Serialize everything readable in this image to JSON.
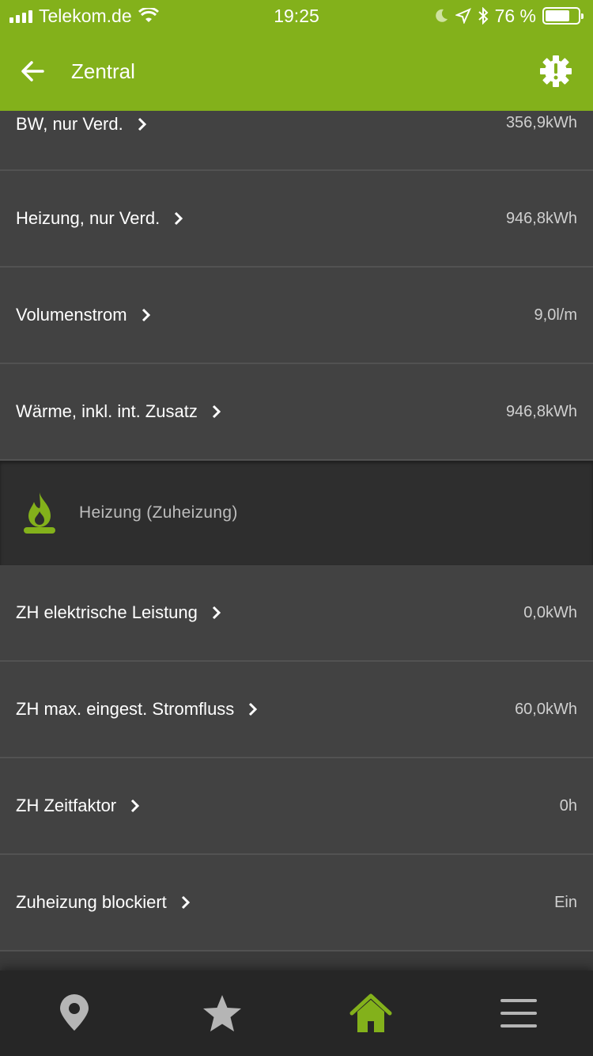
{
  "status": {
    "carrier": "Telekom.de",
    "time": "19:25",
    "battery": "76 %",
    "battery_level": 0.76
  },
  "appbar": {
    "title": "Zentral",
    "back_icon": "arrow-left-icon",
    "alert_icon": "gear-alert-icon"
  },
  "rows_top": [
    {
      "label": "BW, nur Verd.",
      "value": "356,9kWh"
    },
    {
      "label": "Heizung, nur Verd.",
      "value": "946,8kWh"
    },
    {
      "label": "Volumenstrom",
      "value": "9,0l/m"
    },
    {
      "label": "Wärme, inkl. int. Zusatz",
      "value": "946,8kWh"
    }
  ],
  "section": {
    "title": "Heizung (Zuheizung)",
    "icon": "flame-icon"
  },
  "rows_bottom": [
    {
      "label": "ZH elektrische Leistung",
      "value": "0,0kWh"
    },
    {
      "label": "ZH max. eingest. Stromfluss",
      "value": "60,0kWh"
    },
    {
      "label": "ZH Zeitfaktor",
      "value": "0h"
    },
    {
      "label": "Zuheizung blockiert",
      "value": "Ein"
    }
  ],
  "bottom_nav": [
    {
      "icon": "location-pin-icon",
      "active": false
    },
    {
      "icon": "star-icon",
      "active": false
    },
    {
      "icon": "home-icon",
      "active": true
    },
    {
      "icon": "menu-icon",
      "active": false
    }
  ],
  "colors": {
    "accent": "#83b11b",
    "background": "#424242",
    "section_bg": "#2e2e2e",
    "nav_bg": "#262626"
  }
}
